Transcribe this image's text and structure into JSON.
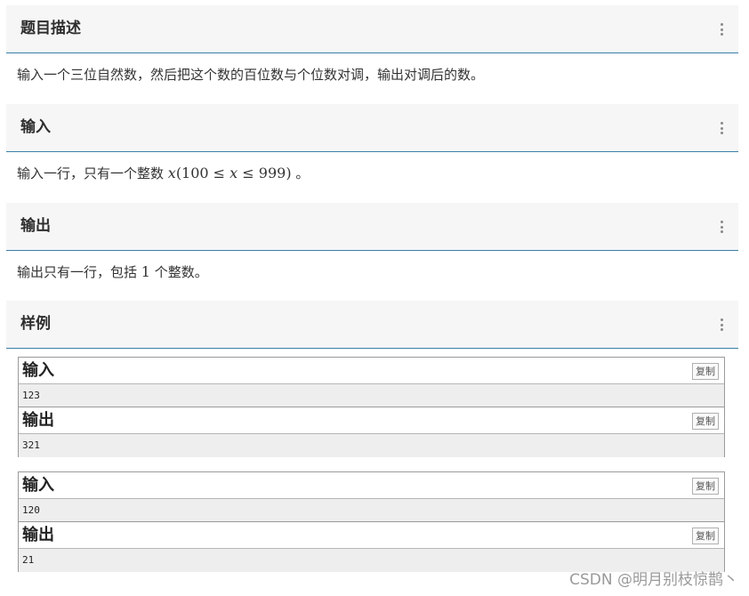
{
  "sections": {
    "description": {
      "title": "题目描述",
      "text": "输入一个三位自然数，然后把这个数的百位数与个位数对调，输出对调后的数。"
    },
    "input": {
      "title": "输入",
      "prefix": "输入一行，只有一个整数 ",
      "math_var": "x",
      "math_expr_a": "(100 ≤ ",
      "math_expr_b": " ≤ 999)",
      "suffix": " 。"
    },
    "output": {
      "title": "输出",
      "prefix": "输出只有一行，包括 ",
      "count": "1",
      "suffix": " 个整数。"
    },
    "samples": {
      "title": "样例"
    }
  },
  "samples": [
    {
      "input_label": "输入",
      "input_value": "123",
      "output_label": "输出",
      "output_value": "321",
      "copy_label": "复制"
    },
    {
      "input_label": "输入",
      "input_value": "120",
      "output_label": "输出",
      "output_value": "21",
      "copy_label": "复制"
    }
  ],
  "watermark": "CSDN @明月别枝惊鹊丶",
  "colors": {
    "header_bg": "#f6f6f6",
    "header_underline": "#3a7fa8",
    "data_row_bg": "#eeeeee"
  },
  "icons": {
    "section_menu": "kebab-vertical-icon"
  }
}
